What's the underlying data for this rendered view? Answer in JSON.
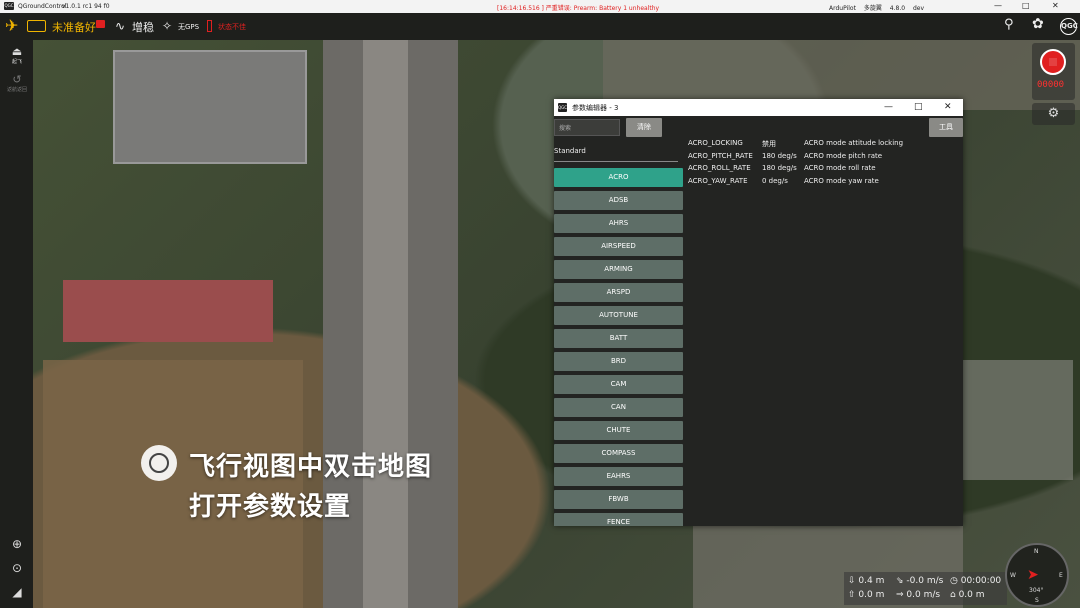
{
  "titlebar": {
    "app_name": "QGroundControl",
    "version": "v1.0.1 rc1 94 f0",
    "alert": "[16:14:16.516 ] 严重错误: Prearm: Battery 1 unhealthy",
    "product": "ArduPilot",
    "product_type": "多旋翼",
    "firmware": "4.8.0",
    "channel": "dev",
    "minimize": "—",
    "maximize": "□",
    "close": "✕"
  },
  "toolbar": {
    "status": "未准备好",
    "mode": "增稳",
    "gps": "无GPS",
    "battery": "状态不佳"
  },
  "leftbar": {
    "takeoff": "起飞",
    "rtl": "返航返回"
  },
  "param_editor": {
    "title": "参数编辑器 - 3",
    "search_placeholder": "搜索",
    "clear_label": "清除",
    "tools_label": "工具",
    "group_label": "Standard",
    "categories": [
      "ACRO",
      "ADSB",
      "AHRS",
      "AIRSPEED",
      "ARMING",
      "ARSPD",
      "AUTOTUNE",
      "BATT",
      "BRD",
      "CAM",
      "CAN",
      "CHUTE",
      "COMPASS",
      "EAHRS",
      "FBWB",
      "FENCE"
    ],
    "selected_category": "ACRO",
    "params": [
      {
        "name": "ACRO_LOCKING",
        "value": "禁用",
        "desc": "ACRO mode attitude locking"
      },
      {
        "name": "ACRO_PITCH_RATE",
        "value": "180 deg/s",
        "desc": "ACRO mode pitch rate"
      },
      {
        "name": "ACRO_ROLL_RATE",
        "value": "180 deg/s",
        "desc": "ACRO mode roll rate"
      },
      {
        "name": "ACRO_YAW_RATE",
        "value": "0 deg/s",
        "desc": "ACRO mode yaw rate"
      }
    ]
  },
  "overlay": {
    "line1": "飞行视图中双击地图",
    "line2": "打开参数设置"
  },
  "video": {
    "timer": "00000"
  },
  "telemetry": {
    "alt": "0.4 m",
    "vspeed": "-0.0 m/s",
    "time": "00:00:00",
    "dist": "0.0 m",
    "hspeed": "0.0 m/s",
    "dist2": "0.0 m"
  },
  "compass": {
    "n": "N",
    "e": "E",
    "s": "S",
    "w": "W",
    "heading": "304°"
  },
  "colors": {
    "accent": "#2fa28a",
    "category_bg": "#5e6e67",
    "alert": "#e02020",
    "warning_yellow": "#f0b400"
  }
}
